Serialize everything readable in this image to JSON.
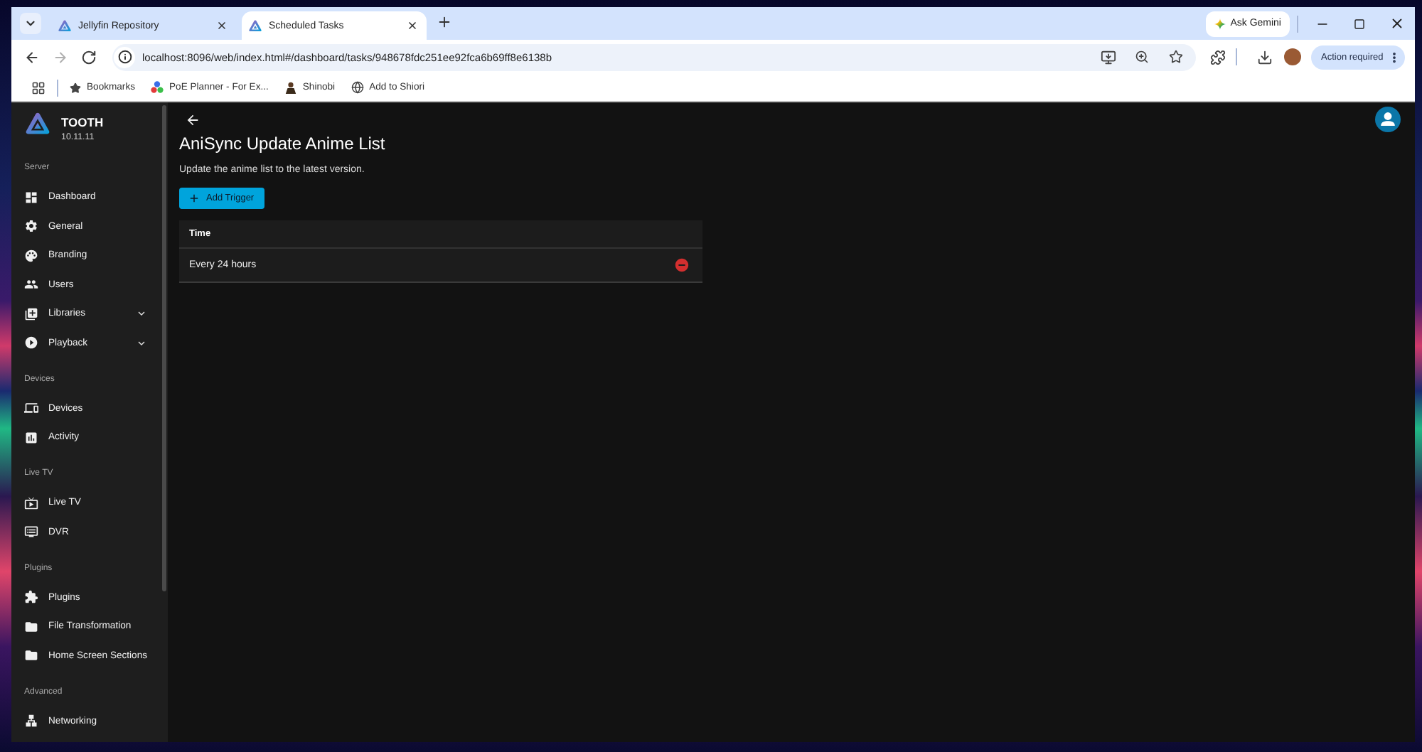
{
  "browser": {
    "tabs": [
      {
        "title": "Jellyfin Repository",
        "selected": false
      },
      {
        "title": "Scheduled Tasks",
        "selected": true
      }
    ],
    "gemini_button": "Ask Gemini",
    "nav_buttons": [
      {
        "kind": "back",
        "disabled": false
      },
      {
        "kind": "forward",
        "disabled": true
      },
      {
        "kind": "reload",
        "disabled": false
      }
    ],
    "address": "localhost:8096/web/index.html#/dashboard/tasks/948678fdc251ee92fca6b69ff8e6138b",
    "action_button": "Action required",
    "bookmarks": [
      {
        "kind": "star",
        "label": "Bookmarks"
      },
      {
        "kind": "poe",
        "label": "PoE Planner - For Ex..."
      },
      {
        "kind": "shinobi",
        "label": "Shinobi"
      },
      {
        "kind": "globe",
        "label": "Add to Shiori"
      }
    ]
  },
  "server": {
    "name": "TOOTH",
    "version": "10.11.11"
  },
  "sidebar": {
    "sections": [
      {
        "title": "Server",
        "items": [
          {
            "kind": "dashboard",
            "label": "Dashboard",
            "selected": false,
            "submenu": false
          },
          {
            "kind": "settings",
            "label": "General",
            "selected": false,
            "submenu": false
          },
          {
            "kind": "palette",
            "label": "Branding",
            "selected": false,
            "submenu": false
          },
          {
            "kind": "people",
            "label": "Users",
            "selected": false,
            "submenu": false
          },
          {
            "kind": "library",
            "label": "Libraries",
            "selected": false,
            "submenu": true
          },
          {
            "kind": "play",
            "label": "Playback",
            "selected": false,
            "submenu": true
          }
        ]
      },
      {
        "title": "Devices",
        "items": [
          {
            "kind": "devices",
            "label": "Devices",
            "selected": false,
            "submenu": false
          },
          {
            "kind": "chart",
            "label": "Activity",
            "selected": false,
            "submenu": false
          }
        ]
      },
      {
        "title": "Live TV",
        "items": [
          {
            "kind": "tv",
            "label": "Live TV",
            "selected": false,
            "submenu": false
          },
          {
            "kind": "dvr",
            "label": "DVR",
            "selected": false,
            "submenu": false
          }
        ]
      },
      {
        "title": "Plugins",
        "items": [
          {
            "kind": "plugin",
            "label": "Plugins",
            "selected": false,
            "submenu": false
          },
          {
            "kind": "folder",
            "label": "File Transformation",
            "selected": false,
            "submenu": false
          },
          {
            "kind": "folder",
            "label": "Home Screen Sections",
            "selected": false,
            "submenu": false
          }
        ]
      },
      {
        "title": "Advanced",
        "items": [
          {
            "kind": "network",
            "label": "Networking",
            "selected": false,
            "submenu": false
          }
        ]
      }
    ]
  },
  "page": {
    "title": "AniSync Update Anime List",
    "description": "Update the anime list to the latest version.",
    "add_button": "Add Trigger",
    "table": {
      "columns": [
        "Time"
      ],
      "rows": [
        {
          "cells": [
            "Every 24 hours"
          ]
        }
      ]
    }
  }
}
